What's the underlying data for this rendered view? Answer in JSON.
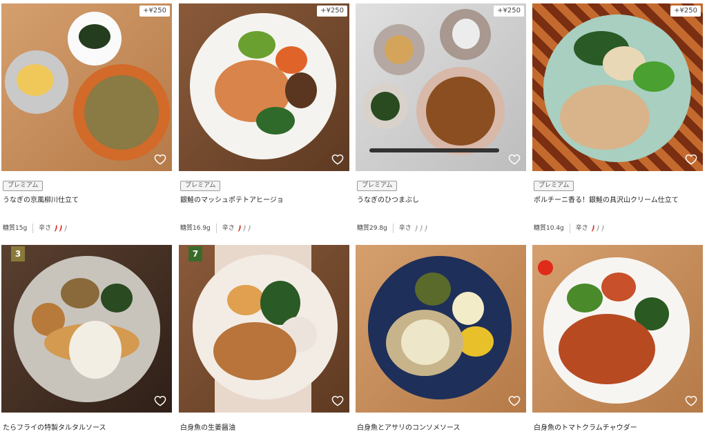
{
  "products": [
    {
      "price": "+¥250",
      "tag": "プレミアム",
      "title": "うなぎの京風柳川仕立て",
      "sugar": "糖質15g",
      "spice_label": "辛さ",
      "spice_level": 2
    },
    {
      "price": "+¥250",
      "tag": "プレミアム",
      "title": "銀鮭のマッシュポテトアヒージョ",
      "sugar": "糖質16.9g",
      "spice_label": "辛さ",
      "spice_level": 1
    },
    {
      "price": "+¥250",
      "tag": "プレミアム",
      "title": "うなぎのひつまぶし",
      "sugar": "糖質29.8g",
      "spice_label": "辛さ",
      "spice_level": 0
    },
    {
      "price": "+¥250",
      "tag": "プレミアム",
      "title": "ポルチーニ香る！銀鮭の具沢山クリーム仕立て",
      "sugar": "糖質10.4g",
      "spice_label": "辛さ",
      "spice_level": 1
    },
    {
      "rank": "3",
      "title": "たらフライの特製タルタルソース"
    },
    {
      "rank": "7",
      "title": "白身魚の生姜醤油"
    },
    {
      "title": "白身魚とアサリのコンソメソース"
    },
    {
      "title": "白身魚のトマトクラムチャウダー"
    }
  ],
  "colors": {
    "chili_red": "#d9302c",
    "chili_gray": "#b8b8b8",
    "rank_gold": "#8a7a3a",
    "rank_green": "#3a6b2a"
  },
  "icons": {
    "favorite": "heart-outline-icon",
    "spice": "chili-pepper-icon"
  }
}
